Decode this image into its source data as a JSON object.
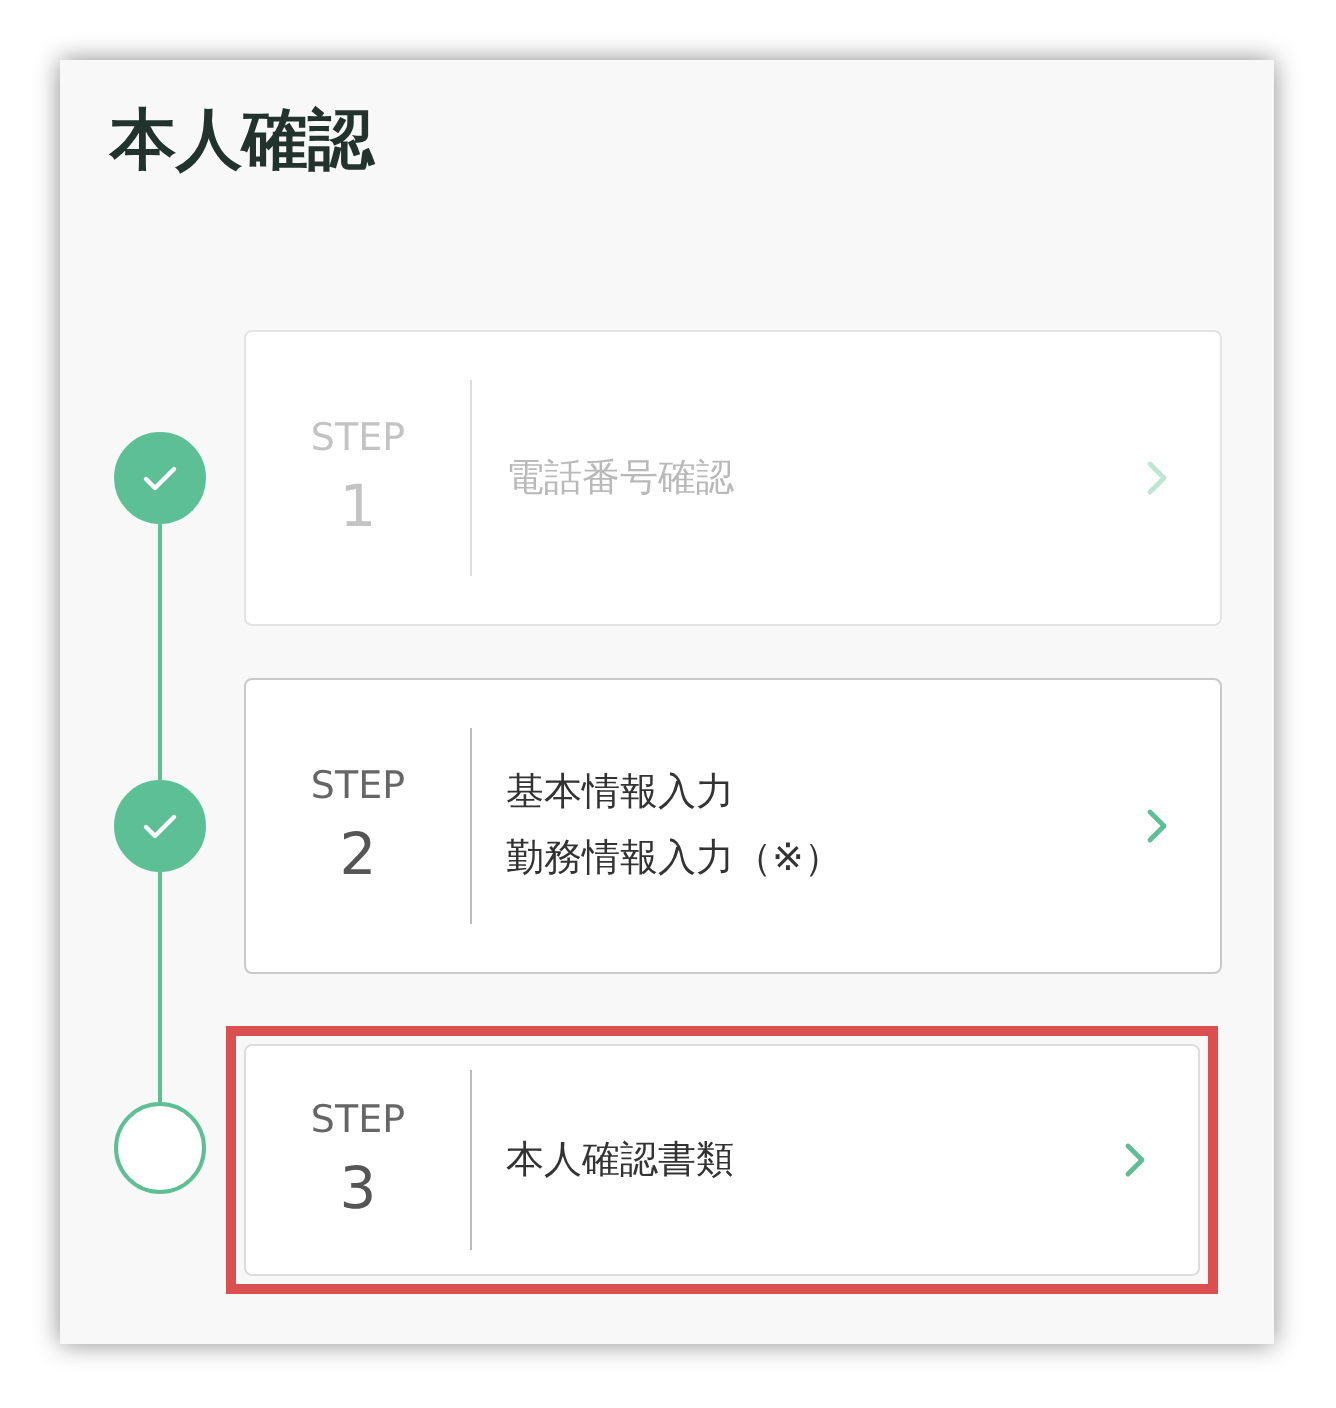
{
  "title": "本人確認",
  "steps": [
    {
      "label": "STEP",
      "number": "1",
      "lines": [
        "電話番号確認"
      ],
      "completed": true,
      "disabled": true,
      "highlighted": false
    },
    {
      "label": "STEP",
      "number": "2",
      "lines": [
        "基本情報入力",
        "勤務情報入力（※）"
      ],
      "completed": true,
      "disabled": false,
      "highlighted": false
    },
    {
      "label": "STEP",
      "number": "3",
      "lines": [
        "本人確認書類"
      ],
      "completed": false,
      "disabled": false,
      "highlighted": true
    }
  ]
}
